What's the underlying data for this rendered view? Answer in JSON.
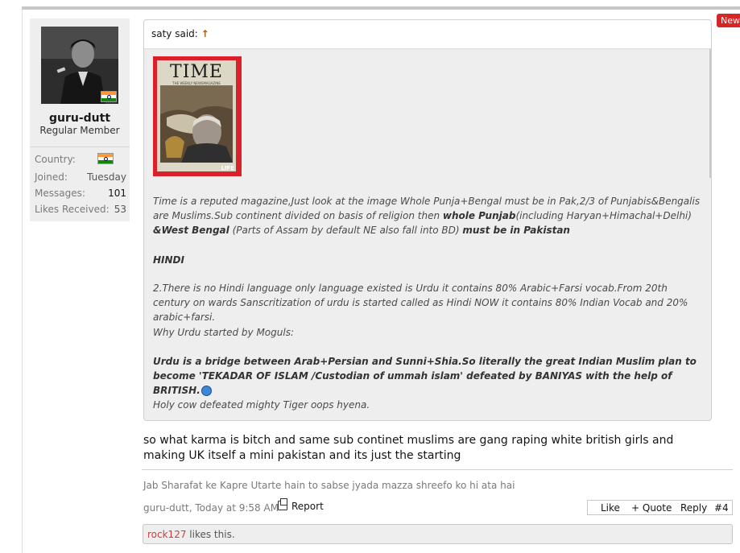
{
  "badge": {
    "new": "New"
  },
  "user": {
    "name": "guru-dutt",
    "title": "Regular Member",
    "country_label": "Country:",
    "joined_label": "Joined:",
    "joined_value": "Tuesday",
    "messages_label": "Messages:",
    "messages_value": "101",
    "likes_label": "Likes Received:",
    "likes_value": "53"
  },
  "quote": {
    "author": "saty said:",
    "arrow": "↑",
    "cover": {
      "logo": "TIME",
      "subtitle": "THE WEEKLY NEWSMAGAZINE",
      "corner": "LIFE"
    },
    "p1_a": "Time is a reputed magazine,Just look at the image Whole Punja+Bengal must be in Pak,2/3 of Punjabis&Bengalis are Muslims.Sub continent divided on basis of religion then ",
    "p1_b": "whole Punjab",
    "p1_c": "(including Haryan+Himachal+Delhi) ",
    "p1_d": "&West Bengal",
    "p1_e": " (Parts of Assam by default NE also fall into BD) ",
    "p1_f": "must be in Pakistan",
    "p2": "HINDI",
    "p3": "2.There is no Hindi language only language existed is Urdu it contains 80% Arabic+Farsi vocab.From 20th century on wards Sanscritization of urdu is started called as Hindi NOW it contains 80% Indian Vocab and 20% arabic+farsi.",
    "p4": "Why Urdu started by Moguls:",
    "p5": "Urdu is a bridge between Arab+Persian and Sunni+Shia.So literally the great Indian Muslim plan to become 'TEKADAR OF ISLAM /Custodian of ummah islam' defeated by BANIYAS with the help of BRITISH.",
    "p6": "Holy cow defeated mighty Tiger oops hyena."
  },
  "message": "so what karma is bitch and same sub continet muslims are gang raping white british girls and making UK itself a mini pakistan and its just the starting",
  "signature": "Jab Sharafat ke Kapre Utarte hain to sabse jyada mazza shreefo ko hi ata hai",
  "meta": {
    "author_time": "guru-dutt, Today at 9:58 AM",
    "report": "Report"
  },
  "actions": {
    "like": "Like",
    "quote": "+ Quote",
    "reply": "Reply",
    "post_num": "#4"
  },
  "likes_bar": {
    "name": "rock127",
    "text": " likes this."
  },
  "colors": {
    "new_badge": "#d72626",
    "flag_saffron": "#FF9933",
    "flag_green": "#138808",
    "liker": "#d43a3a",
    "quote_arrow": "#b35b00"
  }
}
